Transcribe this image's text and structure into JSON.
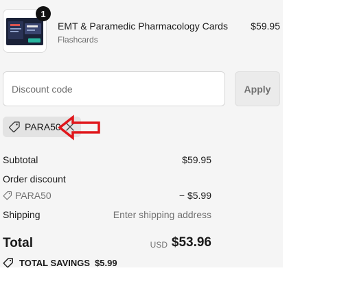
{
  "product": {
    "quantity": "1",
    "title": "EMT & Paramedic Pharmacology Cards",
    "subtitle": "Flashcards",
    "price": "$59.95"
  },
  "discount": {
    "placeholder": "Discount code",
    "apply_label": "Apply",
    "applied_code": "PARA50"
  },
  "summary": {
    "subtotal_label": "Subtotal",
    "subtotal_value": "$59.95",
    "order_discount_label": "Order discount",
    "discount_code": "PARA50",
    "discount_value": "− $5.99",
    "shipping_label": "Shipping",
    "shipping_value": "Enter shipping address",
    "total_label": "Total",
    "currency": "USD",
    "total_value": "$53.96",
    "savings_label": "TOTAL SAVINGS",
    "savings_value": "$5.99"
  },
  "colors": {
    "arrow": "#e0161b",
    "panel_bg": "#f5f5f5"
  },
  "icons": [
    "tag-icon",
    "close-icon",
    "arrow-left-icon"
  ]
}
